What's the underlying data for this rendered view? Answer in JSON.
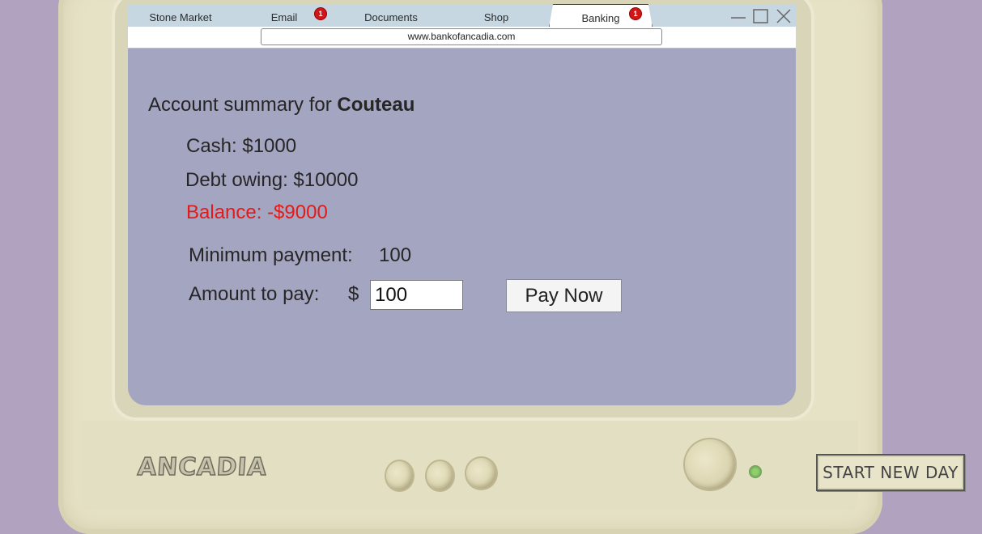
{
  "browser": {
    "tabs": [
      {
        "label": "Stone Market",
        "badge": ""
      },
      {
        "label": "Email",
        "badge": "1"
      },
      {
        "label": "Documents",
        "badge": ""
      },
      {
        "label": "Shop",
        "badge": ""
      },
      {
        "label": "Banking",
        "badge": "1"
      }
    ],
    "active_tab": "Banking",
    "url": "www.bankofancadia.com"
  },
  "account": {
    "summary_prefix": "Account summary for ",
    "name": "Couteau",
    "cash": "Cash: $1000",
    "debt": "Debt owing: $10000",
    "balance": "Balance: -$9000",
    "balance_color": "#e11a1a",
    "min_payment_label": "Minimum payment:",
    "min_payment_value": "100",
    "amount_label": "Amount to pay:",
    "currency": "$",
    "amount_value": "100",
    "pay_button": "Pay Now"
  },
  "monitor": {
    "brand": "ANCADIA",
    "new_day_button": "START NEW DAY"
  },
  "icons": {
    "minimize": "minimize-icon",
    "maximize": "maximize-icon",
    "close": "close-icon"
  }
}
